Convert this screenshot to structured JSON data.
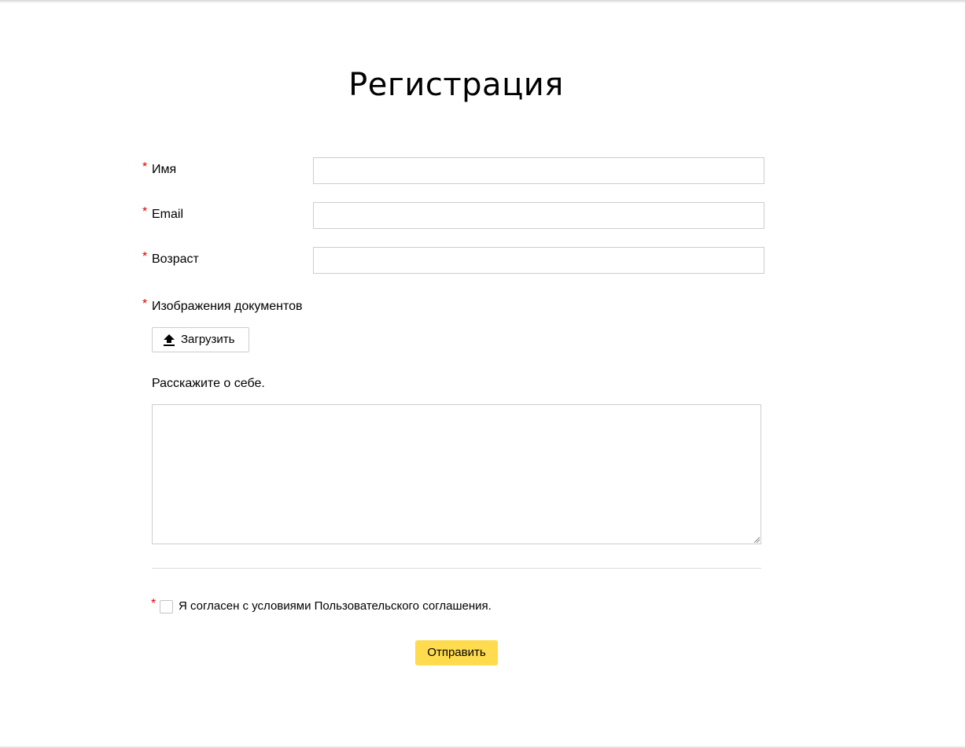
{
  "form": {
    "title": "Регистрация",
    "required_mark": "*",
    "fields": {
      "name": {
        "label": "Имя",
        "value": ""
      },
      "email": {
        "label": "Email",
        "value": ""
      },
      "age": {
        "label": "Возраст",
        "value": ""
      }
    },
    "documents": {
      "label": "Изображения документов",
      "upload_label": "Загрузить",
      "upload_icon": "upload-icon"
    },
    "about": {
      "label": "Расскажите о себе.",
      "value": ""
    },
    "agreement": {
      "label": "Я согласен с условиями Пользовательского соглашения.",
      "checked": false
    },
    "submit_label": "Отправить",
    "colors": {
      "submit_bg": "#ffdb4d",
      "required": "#e00000"
    }
  }
}
